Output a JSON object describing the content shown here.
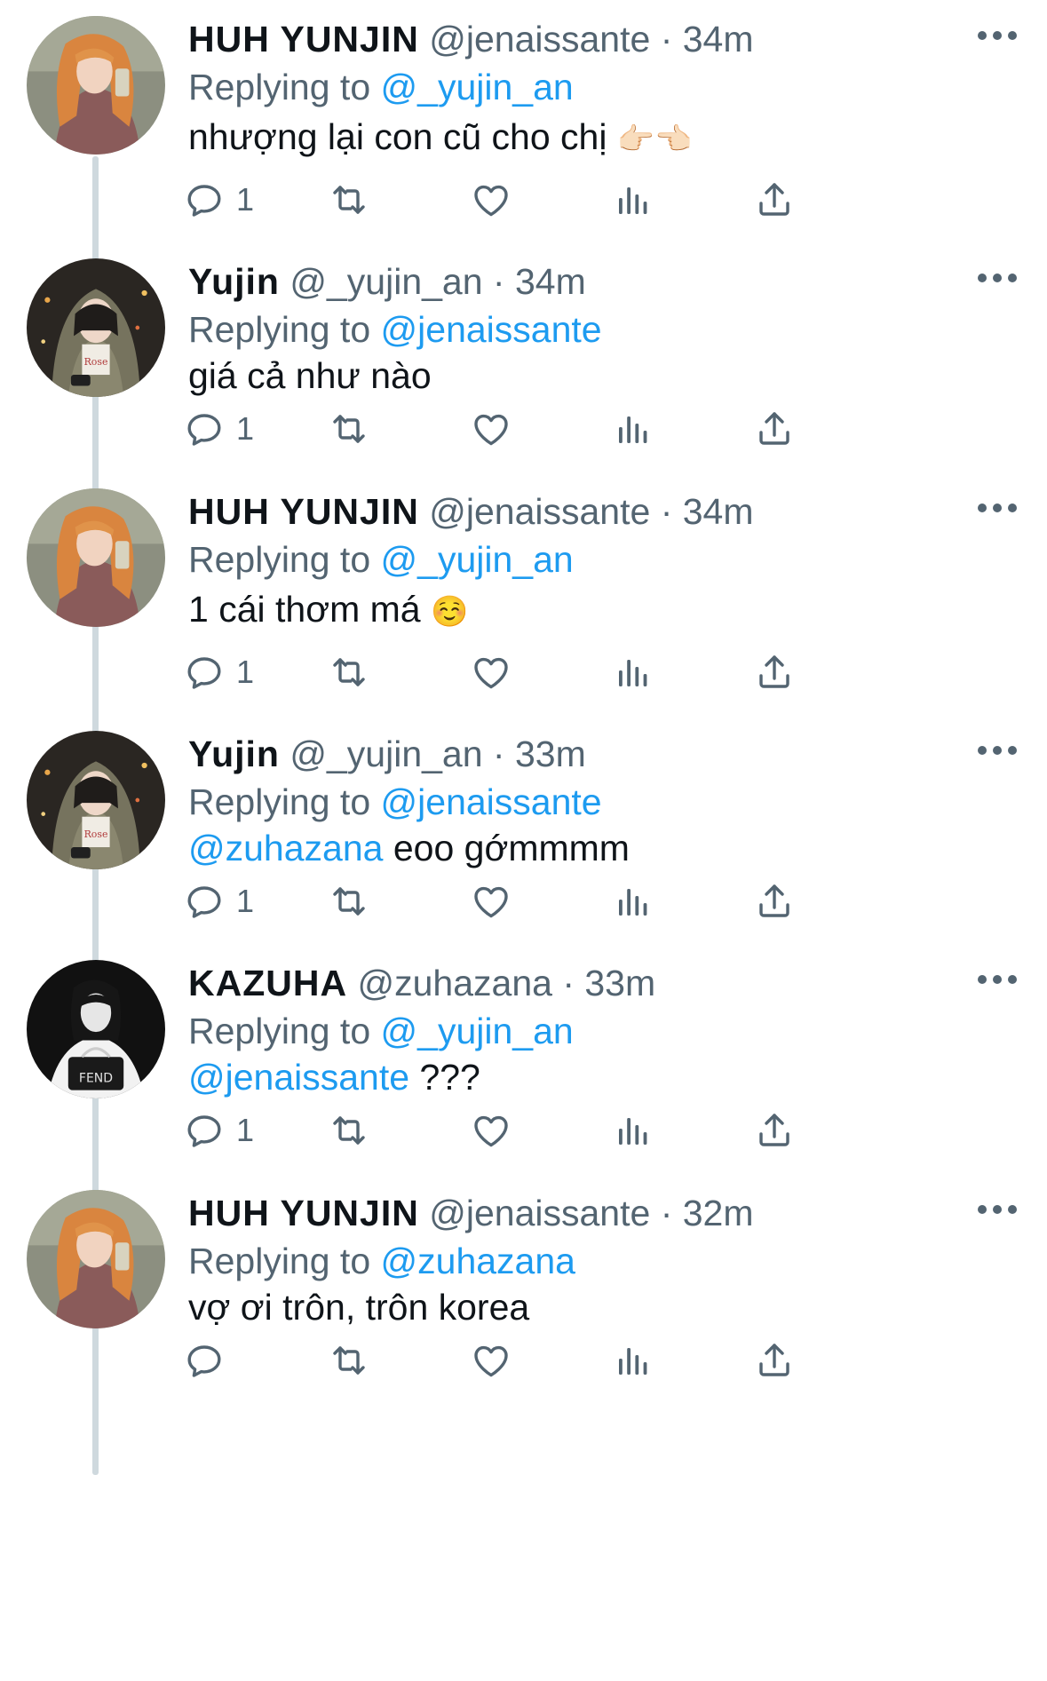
{
  "tweets": [
    {
      "name": "HUH YUNJIN",
      "handle": "@jenaissante",
      "time": "34m",
      "replying_prefix": "Replying to",
      "replying_to": "@_yujin_an",
      "text_mention": "",
      "text": "nhượng lại con cũ cho chị",
      "emoji": "👉🏻👈🏻",
      "reply_count": "1",
      "avatar": "orange-hair-girl"
    },
    {
      "name": "Yujin",
      "handle": "@_yujin_an",
      "time": "34m",
      "replying_prefix": "Replying to",
      "replying_to": "@jenaissante",
      "text_mention": "",
      "text": "giá cả như nào",
      "emoji": "",
      "reply_count": "1",
      "avatar": "hooded-girl"
    },
    {
      "name": "HUH YUNJIN",
      "handle": "@jenaissante",
      "time": "34m",
      "replying_prefix": "Replying to",
      "replying_to": "@_yujin_an",
      "text_mention": "",
      "text": "1 cái thơm má",
      "emoji": "☺️",
      "reply_count": "1",
      "avatar": "orange-hair-girl"
    },
    {
      "name": "Yujin",
      "handle": "@_yujin_an",
      "time": "33m",
      "replying_prefix": "Replying to",
      "replying_to": "@jenaissante",
      "text_mention": "@zuhazana",
      "text": "eoo gớmmmm",
      "emoji": "",
      "reply_count": "1",
      "avatar": "hooded-girl"
    },
    {
      "name": "KAZUHA",
      "handle": "@zuhazana",
      "time": "33m",
      "replying_prefix": "Replying to",
      "replying_to": "@_yujin_an",
      "text_mention": "@jenaissante",
      "text": "???",
      "emoji": "",
      "reply_count": "1",
      "avatar": "black-white-girl"
    },
    {
      "name": "HUH YUNJIN",
      "handle": "@jenaissante",
      "time": "32m",
      "replying_prefix": "Replying to",
      "replying_to": "@zuhazana",
      "text_mention": "",
      "text": "vợ ơi trôn, trôn korea",
      "emoji": "",
      "reply_count": "",
      "avatar": "orange-hair-girl"
    }
  ],
  "icons": {
    "reply": "reply-icon",
    "retweet": "retweet-icon",
    "like": "heart-icon",
    "views": "views-icon",
    "share": "share-icon",
    "more": "more-icon"
  },
  "colors": {
    "accent": "#1d9bf0",
    "secondary_text": "#536471",
    "primary_text": "#0f1419",
    "thread_line": "#cfd9de"
  }
}
